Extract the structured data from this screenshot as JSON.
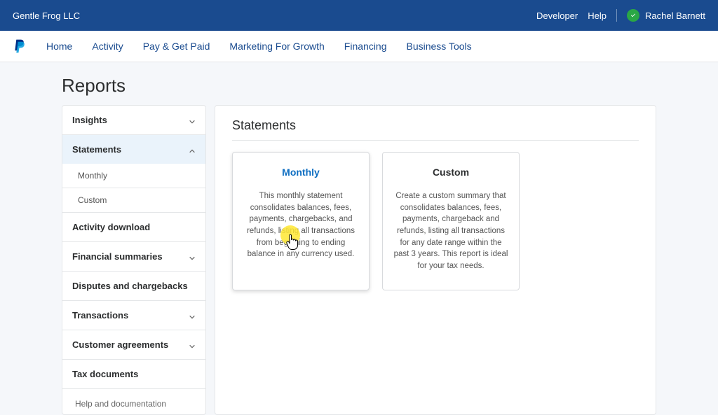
{
  "topbar": {
    "company": "Gentle Frog LLC",
    "developer": "Developer",
    "help": "Help",
    "user": "Rachel Barnett"
  },
  "nav": {
    "home": "Home",
    "activity": "Activity",
    "paygetpaid": "Pay & Get Paid",
    "marketing": "Marketing For Growth",
    "financing": "Financing",
    "biztools": "Business Tools"
  },
  "page": {
    "title": "Reports",
    "section_title": "Statements"
  },
  "sidebar": {
    "insights": "Insights",
    "statements": "Statements",
    "monthly": "Monthly",
    "custom": "Custom",
    "activity_download": "Activity download",
    "financial_summaries": "Financial summaries",
    "disputes": "Disputes and chargebacks",
    "transactions": "Transactions",
    "customer_agreements": "Customer agreements",
    "tax_documents": "Tax documents",
    "help_docs": "Help and documentation"
  },
  "cards": {
    "monthly": {
      "title": "Monthly",
      "desc": "This monthly statement consolidates balances, fees, payments, chargebacks, and refunds, listing all transactions from beginning to ending balance in any currency used."
    },
    "custom": {
      "title": "Custom",
      "desc": "Create a custom summary that consolidates balances, fees, payments, chargeback and refunds, listing all transactions for any date range within the past 3 years. This report is ideal for your tax needs."
    }
  }
}
